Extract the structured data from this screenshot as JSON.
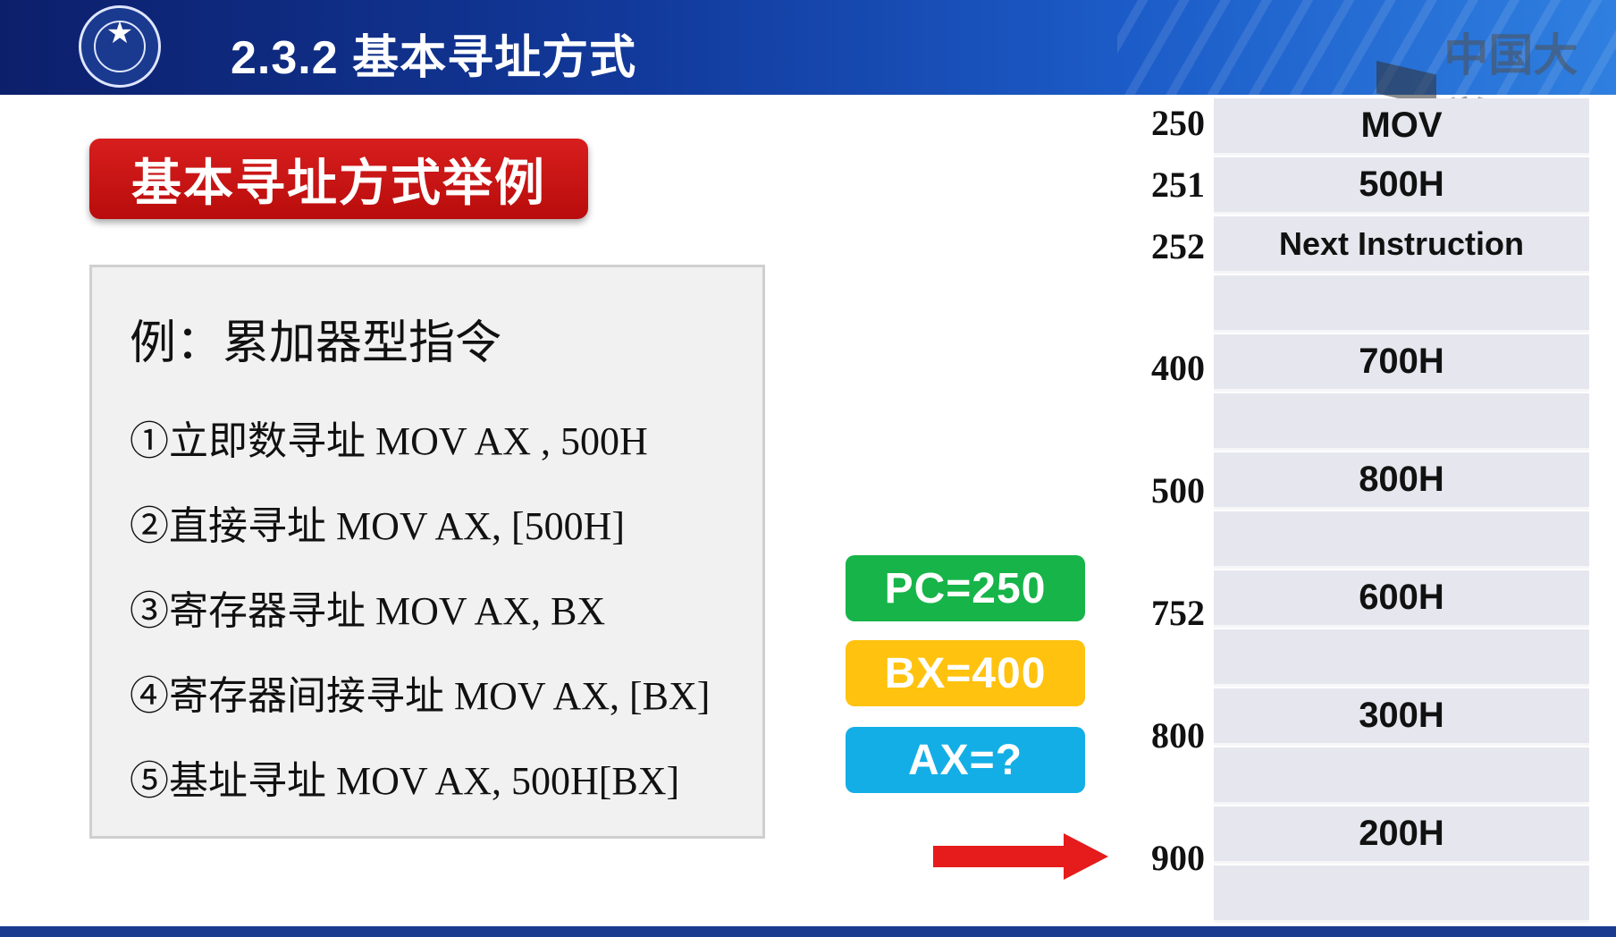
{
  "header": {
    "title": "2.3.2 基本寻址方式",
    "emblem_icon": "university-emblem-icon",
    "watermark": "中国大学",
    "colors": {
      "start": "#0c1f6b",
      "end": "#2f7fe0"
    }
  },
  "section_label": "基本寻址方式举例",
  "example": {
    "heading": "例：累加器型指令",
    "items": [
      "①立即数寻址 MOV  AX , 500H",
      "②直接寻址 MOV  AX, [500H]",
      "③寄存器寻址 MOV  AX,  BX",
      "④寄存器间接寻址 MOV AX,  [BX]",
      "⑤基址寻址 MOV AX, 500H[BX]"
    ]
  },
  "registers": [
    {
      "label": "PC=250",
      "color": "#17b449"
    },
    {
      "label": "BX=400",
      "color": "#ffc20e"
    },
    {
      "label": "AX=?",
      "color": "#13aee6"
    }
  ],
  "pointer_icon": "red-right-arrow-icon",
  "memory": {
    "addresses": [
      "250",
      "251",
      "252",
      "400",
      "500",
      "752",
      "800",
      "900"
    ],
    "cells": [
      "MOV",
      "500H",
      "Next Instruction",
      "",
      "700H",
      "",
      "800H",
      "",
      "600H",
      "",
      "300H",
      "",
      "200H",
      ""
    ]
  }
}
